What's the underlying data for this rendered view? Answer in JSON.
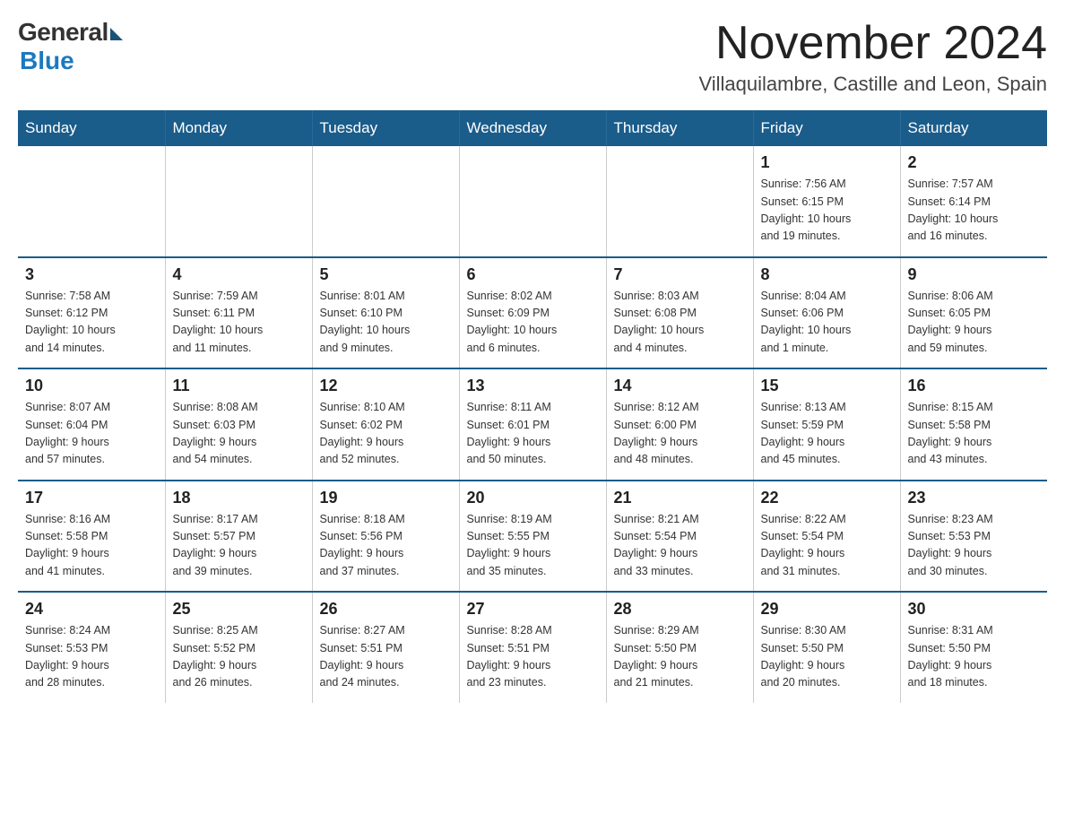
{
  "logo": {
    "general": "General",
    "blue": "Blue"
  },
  "title": "November 2024",
  "subtitle": "Villaquilambre, Castille and Leon, Spain",
  "days_header": [
    "Sunday",
    "Monday",
    "Tuesday",
    "Wednesday",
    "Thursday",
    "Friday",
    "Saturday"
  ],
  "weeks": [
    [
      {
        "day": "",
        "info": ""
      },
      {
        "day": "",
        "info": ""
      },
      {
        "day": "",
        "info": ""
      },
      {
        "day": "",
        "info": ""
      },
      {
        "day": "",
        "info": ""
      },
      {
        "day": "1",
        "info": "Sunrise: 7:56 AM\nSunset: 6:15 PM\nDaylight: 10 hours\nand 19 minutes."
      },
      {
        "day": "2",
        "info": "Sunrise: 7:57 AM\nSunset: 6:14 PM\nDaylight: 10 hours\nand 16 minutes."
      }
    ],
    [
      {
        "day": "3",
        "info": "Sunrise: 7:58 AM\nSunset: 6:12 PM\nDaylight: 10 hours\nand 14 minutes."
      },
      {
        "day": "4",
        "info": "Sunrise: 7:59 AM\nSunset: 6:11 PM\nDaylight: 10 hours\nand 11 minutes."
      },
      {
        "day": "5",
        "info": "Sunrise: 8:01 AM\nSunset: 6:10 PM\nDaylight: 10 hours\nand 9 minutes."
      },
      {
        "day": "6",
        "info": "Sunrise: 8:02 AM\nSunset: 6:09 PM\nDaylight: 10 hours\nand 6 minutes."
      },
      {
        "day": "7",
        "info": "Sunrise: 8:03 AM\nSunset: 6:08 PM\nDaylight: 10 hours\nand 4 minutes."
      },
      {
        "day": "8",
        "info": "Sunrise: 8:04 AM\nSunset: 6:06 PM\nDaylight: 10 hours\nand 1 minute."
      },
      {
        "day": "9",
        "info": "Sunrise: 8:06 AM\nSunset: 6:05 PM\nDaylight: 9 hours\nand 59 minutes."
      }
    ],
    [
      {
        "day": "10",
        "info": "Sunrise: 8:07 AM\nSunset: 6:04 PM\nDaylight: 9 hours\nand 57 minutes."
      },
      {
        "day": "11",
        "info": "Sunrise: 8:08 AM\nSunset: 6:03 PM\nDaylight: 9 hours\nand 54 minutes."
      },
      {
        "day": "12",
        "info": "Sunrise: 8:10 AM\nSunset: 6:02 PM\nDaylight: 9 hours\nand 52 minutes."
      },
      {
        "day": "13",
        "info": "Sunrise: 8:11 AM\nSunset: 6:01 PM\nDaylight: 9 hours\nand 50 minutes."
      },
      {
        "day": "14",
        "info": "Sunrise: 8:12 AM\nSunset: 6:00 PM\nDaylight: 9 hours\nand 48 minutes."
      },
      {
        "day": "15",
        "info": "Sunrise: 8:13 AM\nSunset: 5:59 PM\nDaylight: 9 hours\nand 45 minutes."
      },
      {
        "day": "16",
        "info": "Sunrise: 8:15 AM\nSunset: 5:58 PM\nDaylight: 9 hours\nand 43 minutes."
      }
    ],
    [
      {
        "day": "17",
        "info": "Sunrise: 8:16 AM\nSunset: 5:58 PM\nDaylight: 9 hours\nand 41 minutes."
      },
      {
        "day": "18",
        "info": "Sunrise: 8:17 AM\nSunset: 5:57 PM\nDaylight: 9 hours\nand 39 minutes."
      },
      {
        "day": "19",
        "info": "Sunrise: 8:18 AM\nSunset: 5:56 PM\nDaylight: 9 hours\nand 37 minutes."
      },
      {
        "day": "20",
        "info": "Sunrise: 8:19 AM\nSunset: 5:55 PM\nDaylight: 9 hours\nand 35 minutes."
      },
      {
        "day": "21",
        "info": "Sunrise: 8:21 AM\nSunset: 5:54 PM\nDaylight: 9 hours\nand 33 minutes."
      },
      {
        "day": "22",
        "info": "Sunrise: 8:22 AM\nSunset: 5:54 PM\nDaylight: 9 hours\nand 31 minutes."
      },
      {
        "day": "23",
        "info": "Sunrise: 8:23 AM\nSunset: 5:53 PM\nDaylight: 9 hours\nand 30 minutes."
      }
    ],
    [
      {
        "day": "24",
        "info": "Sunrise: 8:24 AM\nSunset: 5:53 PM\nDaylight: 9 hours\nand 28 minutes."
      },
      {
        "day": "25",
        "info": "Sunrise: 8:25 AM\nSunset: 5:52 PM\nDaylight: 9 hours\nand 26 minutes."
      },
      {
        "day": "26",
        "info": "Sunrise: 8:27 AM\nSunset: 5:51 PM\nDaylight: 9 hours\nand 24 minutes."
      },
      {
        "day": "27",
        "info": "Sunrise: 8:28 AM\nSunset: 5:51 PM\nDaylight: 9 hours\nand 23 minutes."
      },
      {
        "day": "28",
        "info": "Sunrise: 8:29 AM\nSunset: 5:50 PM\nDaylight: 9 hours\nand 21 minutes."
      },
      {
        "day": "29",
        "info": "Sunrise: 8:30 AM\nSunset: 5:50 PM\nDaylight: 9 hours\nand 20 minutes."
      },
      {
        "day": "30",
        "info": "Sunrise: 8:31 AM\nSunset: 5:50 PM\nDaylight: 9 hours\nand 18 minutes."
      }
    ]
  ]
}
